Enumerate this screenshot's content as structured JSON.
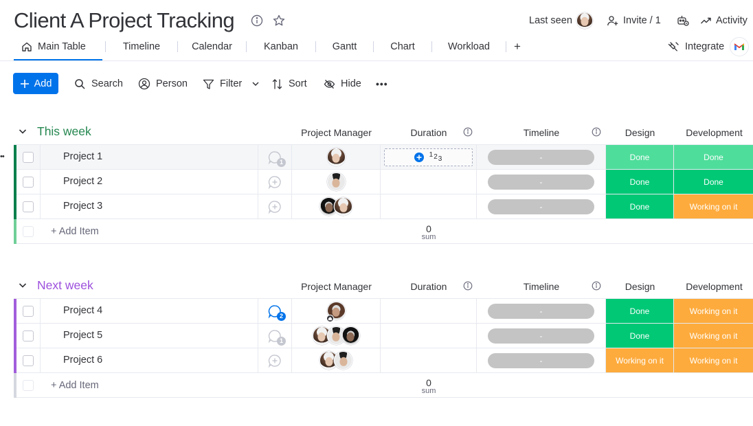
{
  "header": {
    "title": "Client A Project Tracking",
    "last_seen_label": "Last seen",
    "invite_label": "Invite / 1",
    "activity_label": "Activity"
  },
  "tabs": [
    {
      "label": "Main Table",
      "icon": "home-icon",
      "active": true
    },
    {
      "label": "Timeline"
    },
    {
      "label": "Calendar"
    },
    {
      "label": "Kanban"
    },
    {
      "label": "Gantt"
    },
    {
      "label": "Chart"
    },
    {
      "label": "Workload"
    },
    {
      "label": "+"
    }
  ],
  "integrate_label": "Integrate",
  "toolbar": {
    "add_label": "Add",
    "search_label": "Search",
    "person_label": "Person",
    "filter_label": "Filter",
    "sort_label": "Sort",
    "hide_label": "Hide",
    "more_label": "•••"
  },
  "columns": {
    "project_manager": "Project Manager",
    "duration": "Duration",
    "timeline": "Timeline",
    "design": "Design",
    "development": "Development"
  },
  "colors": {
    "accent": "#0073ea",
    "group1": "#037f4c",
    "group1_title": "#258750",
    "group2": "#a25ddc",
    "group2_title": "#9d50dd",
    "done": "#00c875",
    "done_light": "#4fdd9b",
    "working": "#fdab3d",
    "timeline_empty": "#c4c4c4"
  },
  "groups": [
    {
      "title": "This week",
      "rows": [
        {
          "name": "Project 1",
          "updates": "1",
          "timeline": "-",
          "design": "Done",
          "development": "Done"
        },
        {
          "name": "Project 2",
          "updates": "",
          "timeline": "-",
          "design": "Done",
          "development": "Done"
        },
        {
          "name": "Project 3",
          "updates": "",
          "timeline": "-",
          "design": "Done",
          "development": "Working on it"
        }
      ],
      "add_item": "+ Add Item",
      "sum_value": "0",
      "sum_label": "sum"
    },
    {
      "title": "Next week",
      "rows": [
        {
          "name": "Project 4",
          "updates": "2",
          "timeline": "-",
          "design": "Done",
          "development": "Working on it"
        },
        {
          "name": "Project 5",
          "updates": "1",
          "timeline": "-",
          "design": "Done",
          "development": "Working on it"
        },
        {
          "name": "Project 6",
          "updates": "",
          "timeline": "-",
          "design": "Working on it",
          "development": "Working on it"
        }
      ],
      "add_item": "+ Add Item",
      "sum_value": "0",
      "sum_label": "sum"
    }
  ],
  "duration_placeholder": "123"
}
